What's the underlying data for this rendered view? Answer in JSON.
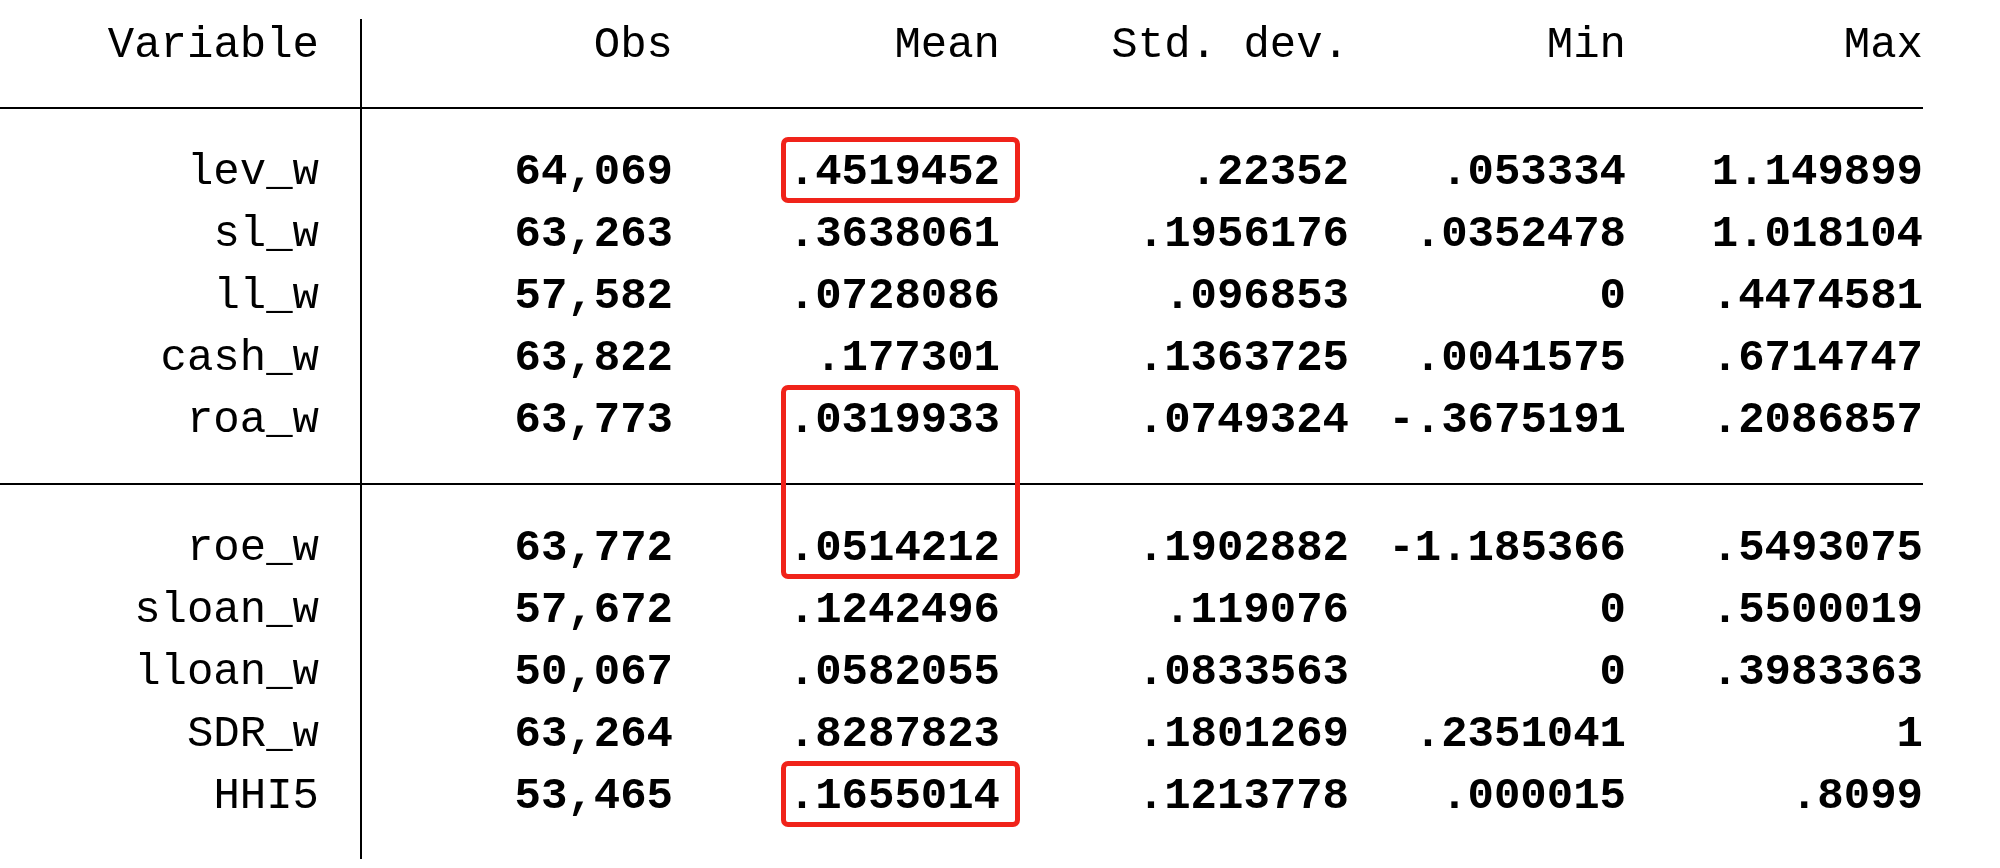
{
  "columns": [
    "Variable",
    "Obs",
    "Mean",
    "Std. dev.",
    "Min",
    "Max"
  ],
  "groups": [
    {
      "rows": [
        {
          "variable": "lev_w",
          "obs": "64,069",
          "mean": ".4519452",
          "std_dev": ".22352",
          "min": ".053334",
          "max": "1.149899",
          "mean_boxed": true
        },
        {
          "variable": "sl_w",
          "obs": "63,263",
          "mean": ".3638061",
          "std_dev": ".1956176",
          "min": ".0352478",
          "max": "1.018104",
          "mean_boxed": false
        },
        {
          "variable": "ll_w",
          "obs": "57,582",
          "mean": ".0728086",
          "std_dev": ".096853",
          "min": "0",
          "max": ".4474581",
          "mean_boxed": false
        },
        {
          "variable": "cash_w",
          "obs": "63,822",
          "mean": ".177301",
          "std_dev": ".1363725",
          "min": ".0041575",
          "max": ".6714747",
          "mean_boxed": false
        },
        {
          "variable": "roa_w",
          "obs": "63,773",
          "mean": ".0319933",
          "std_dev": ".0749324",
          "min": "-.3675191",
          "max": ".2086857",
          "mean_boxed": true
        }
      ]
    },
    {
      "rows": [
        {
          "variable": "roe_w",
          "obs": "63,772",
          "mean": ".0514212",
          "std_dev": ".1902882",
          "min": "-1.185366",
          "max": ".5493075",
          "mean_boxed": true
        },
        {
          "variable": "sloan_w",
          "obs": "57,672",
          "mean": ".1242496",
          "std_dev": ".119076",
          "min": "0",
          "max": ".5500019",
          "mean_boxed": false
        },
        {
          "variable": "lloan_w",
          "obs": "50,067",
          "mean": ".0582055",
          "std_dev": ".0833563",
          "min": "0",
          "max": ".3983363",
          "mean_boxed": false
        },
        {
          "variable": "SDR_w",
          "obs": "63,264",
          "mean": ".8287823",
          "std_dev": ".1801269",
          "min": ".2351041",
          "max": "1",
          "mean_boxed": false
        },
        {
          "variable": "HHI5",
          "obs": "53,465",
          "mean": ".1655014",
          "std_dev": ".1213778",
          "min": ".000015",
          "max": ".8099",
          "mean_boxed": true
        }
      ]
    }
  ]
}
